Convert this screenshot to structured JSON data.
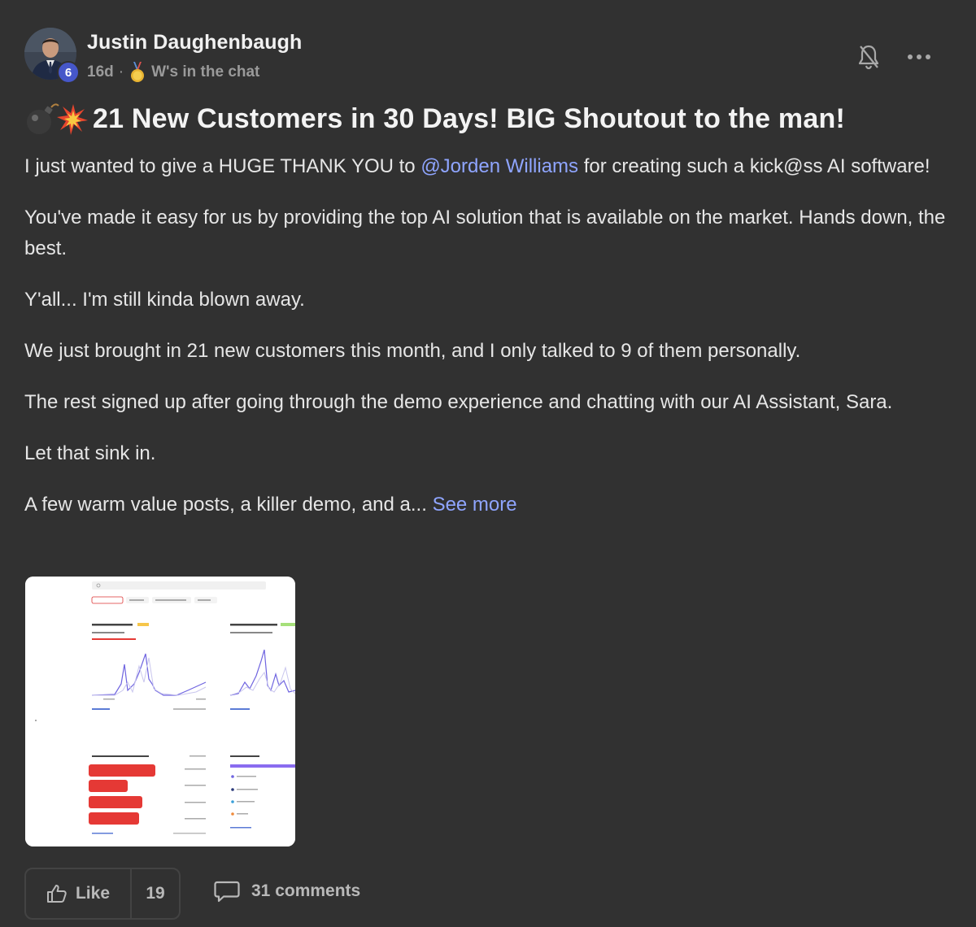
{
  "author": {
    "name": "Justin Daughenbaugh",
    "level": "6",
    "time": "16d",
    "separator": "·",
    "category": "W's in the chat",
    "category_icon": "gold-medal-icon"
  },
  "actions": {
    "bell_icon": "bell-off-icon",
    "more_icon": "more-options-icon"
  },
  "post": {
    "title": "21 New Customers in 30 Days! BIG Shoutout to the man!",
    "title_icon": "bomb-explosion-emoji",
    "p1_before": "I just wanted to give a HUGE THANK YOU to ",
    "mention": "@Jorden Williams",
    "p1_after": " for creating such a kick@ss AI software!",
    "p2": "You've made it easy for us by providing the top AI solution that is available on the market. Hands down, the best.",
    "p3": "Y'all... I'm still kinda blown away.",
    "p4": "We just brought in 21 new customers this month, and I only talked to 9 of them personally.",
    "p5": "The rest signed up after going through the demo experience and chatting with our AI Assistant, Sara.",
    "p6": "Let that sink in.",
    "p7": "A few warm value posts, a killer demo, and a... ",
    "see_more": "See more"
  },
  "attachment": {
    "kind": "dashboard-screenshot",
    "accent": "#e53935",
    "line_color": "#6f64e0"
  },
  "footer": {
    "like_label": "Like",
    "like_count": "19",
    "comments_label": "31 comments"
  },
  "colors": {
    "background": "#313131",
    "link": "#8fa5ff",
    "badge": "#4657c9"
  }
}
